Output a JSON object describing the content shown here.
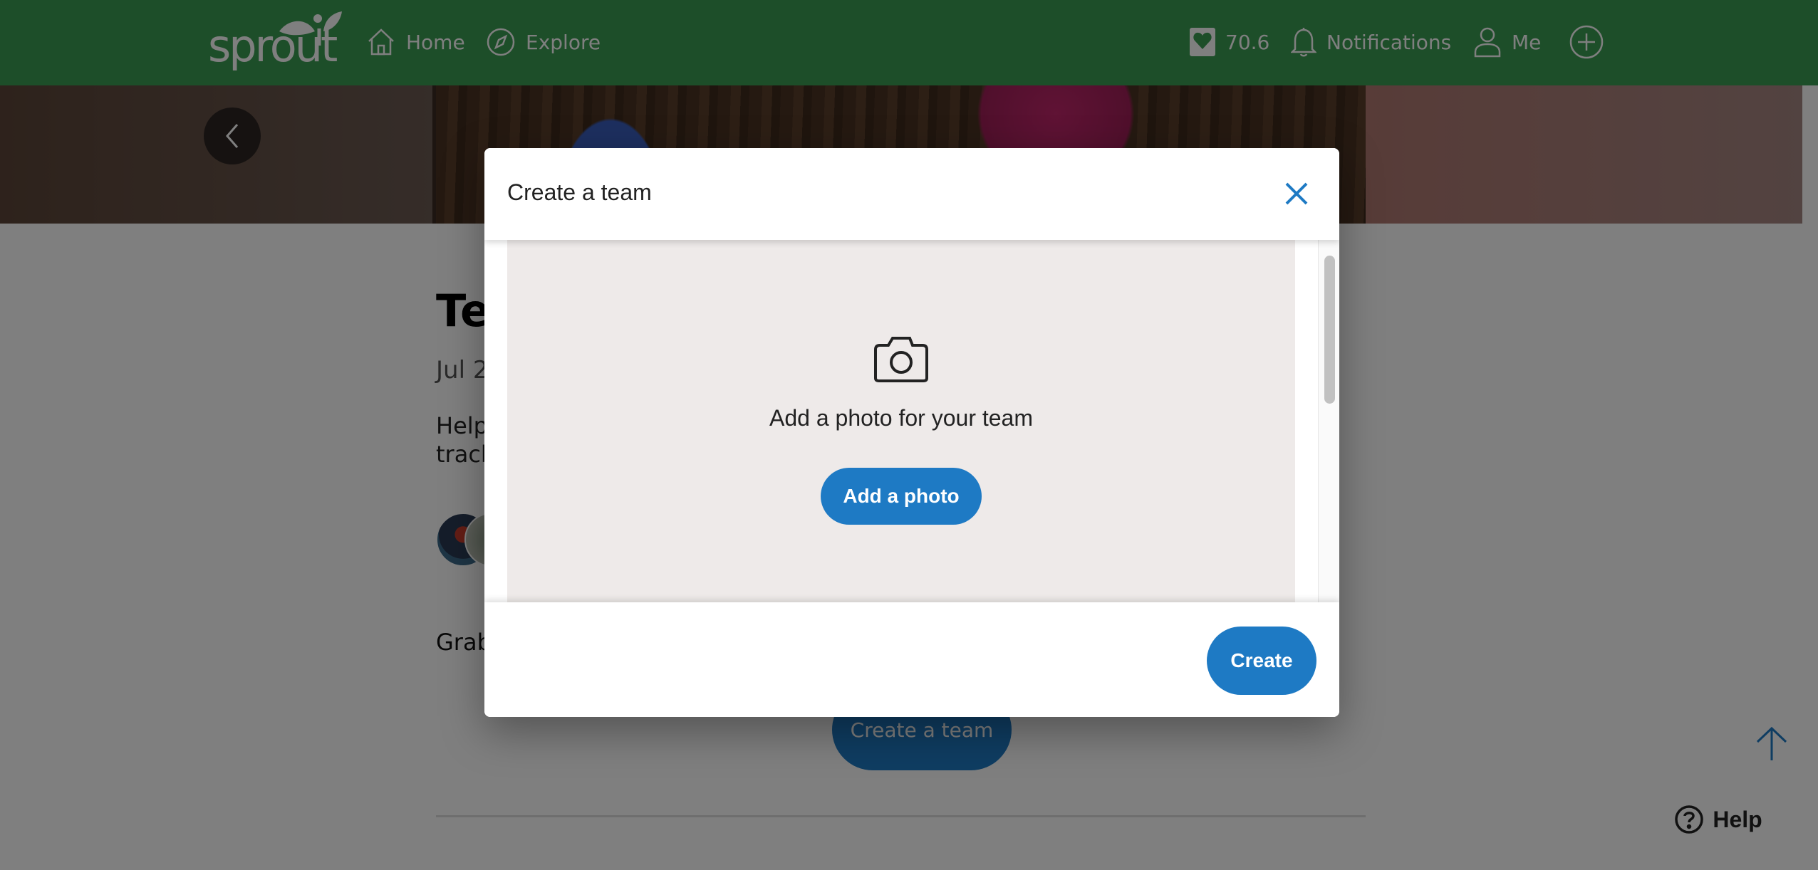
{
  "header": {
    "logo_text": "sprout",
    "nav": {
      "home": "Home",
      "explore": "Explore",
      "points": "70.6",
      "notifications": "Notifications",
      "me": "Me"
    }
  },
  "page": {
    "team_title_partial": "Te",
    "date_partial": "Jul 2",
    "description_line1_partial": "Help",
    "description_line2_partial": "track",
    "grab_text_partial": "Grab",
    "create_team_button": "Create a team"
  },
  "modal": {
    "title": "Create a team",
    "photo_prompt": "Add a photo for your team",
    "add_photo_button": "Add a photo",
    "create_button": "Create",
    "scroll_position": 0.0
  },
  "floating": {
    "help_label": "Help"
  },
  "colors": {
    "header_green": "#3a9c53",
    "primary_blue": "#1e7ac4",
    "photo_area_bg": "#eeeae9"
  }
}
